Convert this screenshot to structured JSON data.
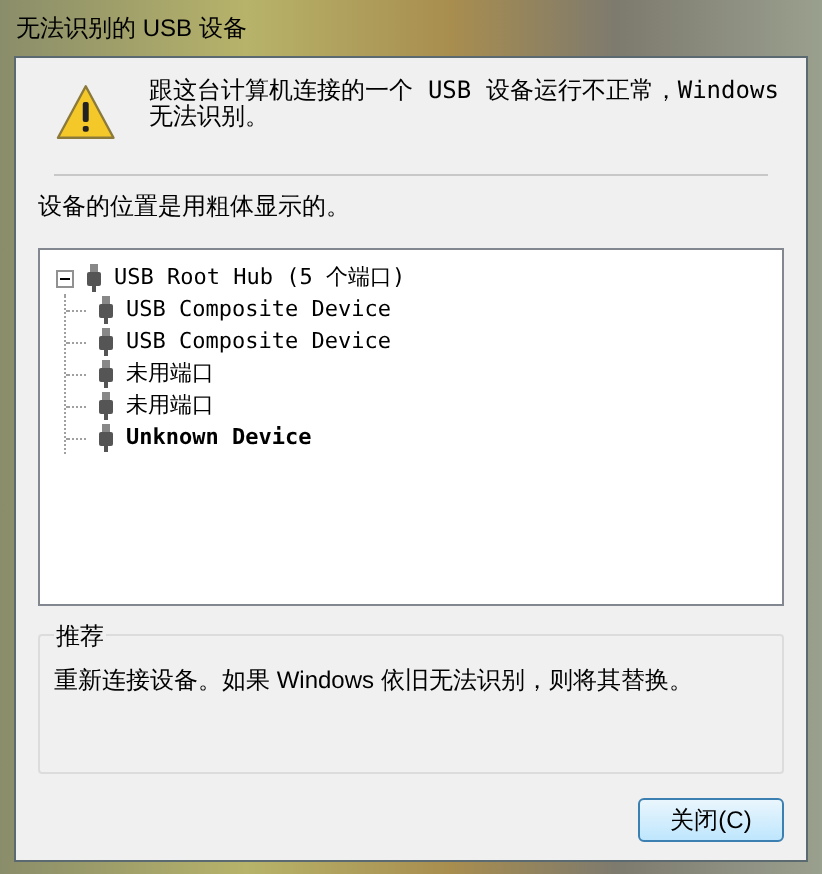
{
  "window": {
    "title": "无法识别的 USB 设备"
  },
  "message": "跟这台计算机连接的一个 USB 设备运行不正常，Windows 无法识别。",
  "hint": "设备的位置是用粗体显示的。",
  "tree": [
    {
      "label": "USB Root Hub (5 个端口)",
      "expanded": true,
      "bold": false,
      "children": [
        {
          "label": "USB Composite Device",
          "bold": false
        },
        {
          "label": "USB Composite Device",
          "bold": false
        },
        {
          "label": "未用端口",
          "bold": false
        },
        {
          "label": "未用端口",
          "bold": false
        },
        {
          "label": "Unknown Device",
          "bold": true
        }
      ]
    }
  ],
  "recommendation": {
    "title": "推荐",
    "text": "重新连接设备。如果 Windows 依旧无法识别，则将其替换。"
  },
  "buttons": [
    "关闭(C)"
  ]
}
